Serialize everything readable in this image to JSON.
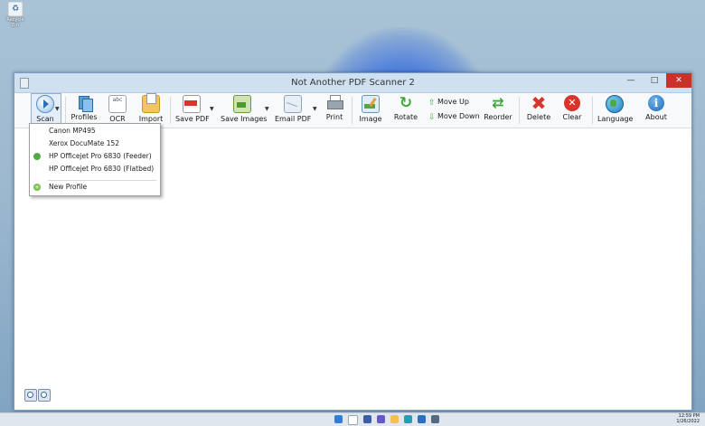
{
  "window": {
    "title": "Not Another PDF Scanner 2"
  },
  "desktop": {
    "recycle_label": "Recycle Bin"
  },
  "toolbar": {
    "scan": "Scan",
    "profiles": "Profiles",
    "ocr": "OCR",
    "ocr_glyph": "abc",
    "import": "Import",
    "save_pdf": "Save PDF",
    "save_images": "Save Images",
    "email_pdf": "Email PDF",
    "print": "Print",
    "image": "Image",
    "rotate": "Rotate",
    "move_up": "Move Up",
    "move_down": "Move Down",
    "reorder": "Reorder",
    "delete": "Delete",
    "clear": "Clear",
    "language": "Language",
    "about": "About"
  },
  "scan_menu": {
    "items": [
      {
        "label": "Canon MP495",
        "checked": false
      },
      {
        "label": "Xerox DocuMate 152",
        "checked": false
      },
      {
        "label": "HP Officejet Pro 6830 (Feeder)",
        "checked": true
      },
      {
        "label": "HP Officejet Pro 6830 (Flatbed)",
        "checked": false
      }
    ],
    "new_profile": "New Profile"
  },
  "taskbar": {
    "time": "12:59 PM",
    "date": "1/26/2022"
  }
}
